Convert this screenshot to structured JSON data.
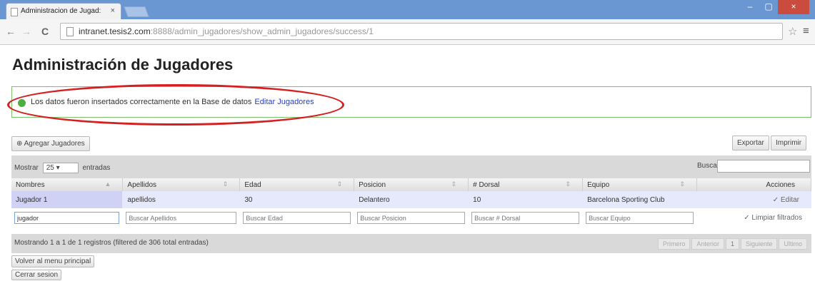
{
  "browser": {
    "tab_title": "Administracion de Jugad:",
    "tab_close": "×",
    "url_host": "intranet.tesis2.com",
    "url_rest": ":8888/admin_jugadores/show_admin_jugadores/success/1",
    "window_buttons": {
      "minimize": "–",
      "maximize": "▢",
      "close": "×"
    },
    "nav": {
      "back": "←",
      "forward": "→",
      "reload": "C"
    },
    "star": "☆",
    "menu": "≡"
  },
  "page": {
    "title": "Administración de Jugadores",
    "alert": {
      "message": "Los datos fueron insertados correctamente en la Base de datos",
      "link": "Editar Jugadores"
    },
    "add_button": "Agregar Jugadores",
    "export_button": "Exportar",
    "print_button": "Imprimir",
    "length": {
      "prefix": "Mostrar",
      "selected": "25",
      "suffix": "entradas"
    },
    "search_label": "Buscar:",
    "table": {
      "columns": [
        "Nombres",
        "Apellidos",
        "Edad",
        "Posicion",
        "# Dorsal",
        "Equipo",
        "Acciones"
      ],
      "rows": [
        {
          "nombres": "Jugador 1",
          "apellidos": "apellidos",
          "edad": "30",
          "posicion": "Delantero",
          "dorsal": "10",
          "equipo": "Barcelona Sporting Club",
          "accion": "Editar"
        }
      ],
      "filters": {
        "nombres_value": "jugador",
        "apellidos_placeholder": "Buscar Apellidos",
        "edad_placeholder": "Buscar Edad",
        "posicion_placeholder": "Buscar Posicion",
        "dorsal_placeholder": "Buscar # Dorsal",
        "equipo_placeholder": "Buscar Equipo",
        "clear_label": "Limpiar filtrados"
      }
    },
    "info": "Mostrando 1 a 1 de 1 registros (filtered de 306 total entradas)",
    "pager": {
      "first": "Primero",
      "previous": "Anterior",
      "current": "1",
      "next": "Siguiente",
      "last": "Ultimo"
    },
    "back_button": "Volver al menu principal",
    "logout_button": "Cerrar sesion"
  }
}
